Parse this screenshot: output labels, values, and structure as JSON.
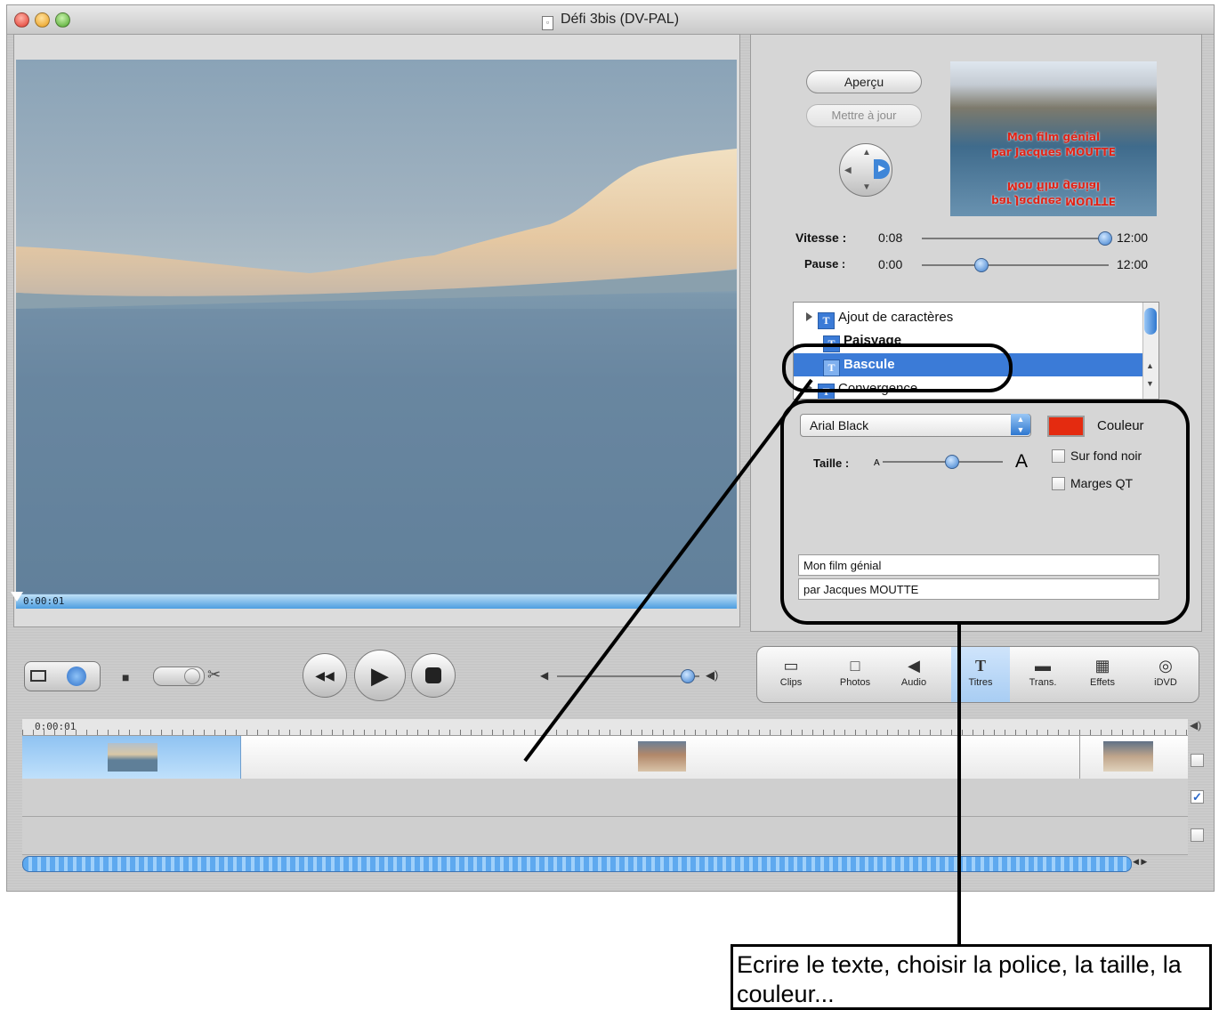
{
  "window": {
    "title": "Défi 3bis (DV-PAL)"
  },
  "viewer": {
    "playhead_time": "0:00:01"
  },
  "preview": {
    "apercu_label": "Aperçu",
    "update_label": "Mettre à jour",
    "thumb_lines": [
      "Mon film génial",
      "par Jacques MOUTTE",
      "Mon film génial",
      "par Jacques MOUTTE"
    ]
  },
  "speed": {
    "label": "Vitesse :",
    "value": "0:08",
    "max": "12:00",
    "fraction": 0.98
  },
  "pause": {
    "label": "Pause :",
    "value": "0:00",
    "max": "12:00",
    "fraction": 0.32
  },
  "titles_list": [
    {
      "label": "Ajout de caractères",
      "expandable": true,
      "selected": false
    },
    {
      "label": "Paisyage",
      "expandable": false,
      "selected": false
    },
    {
      "label": "Bascule",
      "expandable": false,
      "selected": true
    },
    {
      "label": "Convergence",
      "expandable": true,
      "selected": false
    }
  ],
  "font": {
    "selected": "Arial Black",
    "color_label": "Couleur",
    "color_value": "#e42b10",
    "size_label": "Taille :",
    "size_small": "A",
    "size_big": "A",
    "size_fraction": 0.58,
    "black_bg_label": "Sur fond noir",
    "qt_margins_label": "Marges QT"
  },
  "text_lines": [
    "Mon film génial",
    "par Jacques MOUTTE"
  ],
  "panes": [
    {
      "label": "Clips",
      "icon": "clips-icon",
      "glyph": "▭",
      "active": false
    },
    {
      "label": "Photos",
      "icon": "photos-icon",
      "glyph": "□",
      "active": false
    },
    {
      "label": "Audio",
      "icon": "audio-icon",
      "glyph": "◀",
      "active": false
    },
    {
      "label": "Titres",
      "icon": "titles-icon",
      "glyph": "T",
      "active": true
    },
    {
      "label": "Trans.",
      "icon": "transitions-icon",
      "glyph": "▬",
      "active": false
    },
    {
      "label": "Effets",
      "icon": "effects-icon",
      "glyph": "▦",
      "active": false
    },
    {
      "label": "iDVD",
      "icon": "idvd-icon",
      "glyph": "◎",
      "active": false
    }
  ],
  "volume": {
    "fraction": 0.92
  },
  "timeline": {
    "time": "0:00:01"
  },
  "annotation": {
    "text": "Ecrire le texte, choisir la police, la taille, la couleur..."
  }
}
